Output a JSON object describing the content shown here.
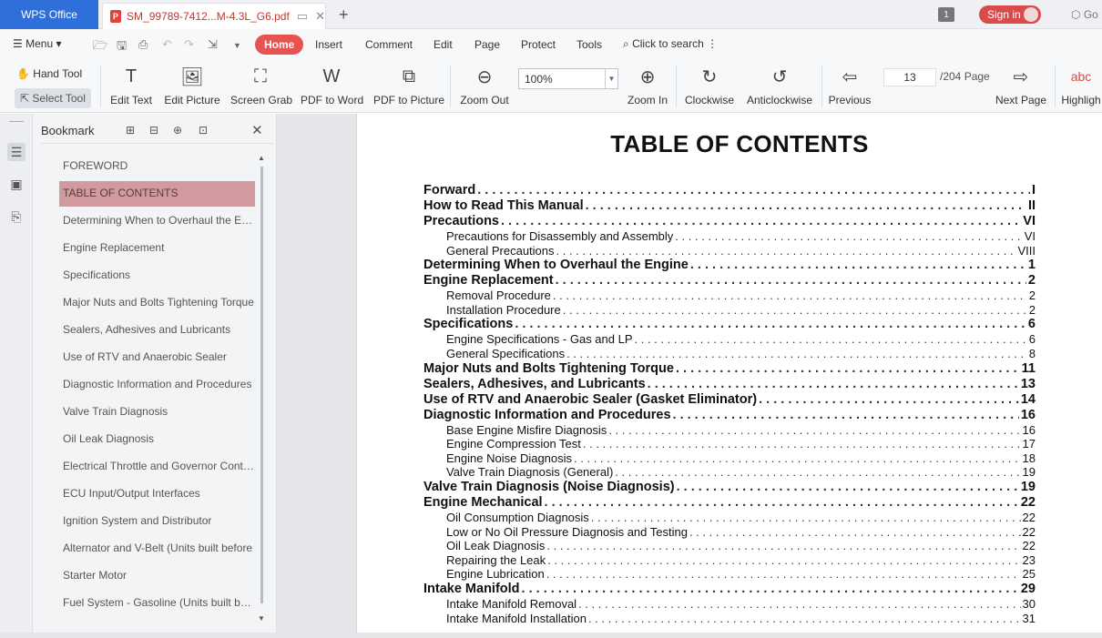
{
  "titlebar": {
    "app_name": "WPS Office",
    "doc_tab": "SM_99789-7412...M-4.3L_G6.pdf",
    "window_count": "1",
    "signin": "Sign in",
    "go_label": "Go"
  },
  "menubar": {
    "menu_label": "Menu",
    "tabs": [
      "Home",
      "Insert",
      "Comment",
      "Edit",
      "Page",
      "Protect",
      "Tools"
    ],
    "search_label": "Click to search"
  },
  "toolbar": {
    "hand_tool": "Hand Tool",
    "select_tool": "Select Tool",
    "edit_text": "Edit Text",
    "edit_picture": "Edit Picture",
    "screen_grab": "Screen Grab",
    "pdf_to_word": "PDF to Word",
    "pdf_to_picture": "PDF to Picture",
    "zoom_out": "Zoom Out",
    "zoom_value": "100%",
    "zoom_in": "Zoom In",
    "clockwise": "Clockwise",
    "anticlockwise": "Anticlockwise",
    "previous": "Previous",
    "page_number": "13",
    "page_total": "/204 Page",
    "next_page": "Next Page",
    "highlight": "Highligh"
  },
  "bookmark": {
    "title": "Bookmark",
    "items": [
      "FOREWORD",
      "TABLE OF CONTENTS",
      "Determining When to Overhaul the Engine",
      "Engine Replacement",
      "Specifications",
      "Major Nuts and Bolts Tightening Torque",
      "Sealers, Adhesives and Lubricants",
      "Use of RTV and Anaerobic Sealer",
      "Diagnostic Information and Procedures",
      "Valve Train Diagnosis",
      "Oil Leak Diagnosis",
      "Electrical Throttle and Governor Control",
      "ECU Input/Output Interfaces",
      "Ignition System and Distributor",
      "Alternator and V-Belt (Units built before",
      "Starter Motor",
      "Fuel System - Gasoline (Units built before"
    ],
    "selected_index": 1
  },
  "document": {
    "heading": "TABLE OF CONTENTS",
    "entries": [
      {
        "title": "Forward",
        "page": "I",
        "level": "main"
      },
      {
        "title": "How to Read This Manual",
        "page": "II",
        "level": "main"
      },
      {
        "title": "Precautions",
        "page": "VI",
        "level": "main"
      },
      {
        "title": "Precautions for Disassembly and Assembly",
        "page": "VI",
        "level": "sub"
      },
      {
        "title": "General Precautions",
        "page": "VIII",
        "level": "sub"
      },
      {
        "title": "Determining When to Overhaul the Engine",
        "page": "1",
        "level": "main"
      },
      {
        "title": "Engine Replacement",
        "page": "2",
        "level": "main"
      },
      {
        "title": "Removal Procedure",
        "page": "2",
        "level": "sub"
      },
      {
        "title": "Installation Procedure",
        "page": "2",
        "level": "sub"
      },
      {
        "title": "Specifications",
        "page": "6",
        "level": "main"
      },
      {
        "title": "Engine Specifications - Gas and LP",
        "page": "6",
        "level": "sub"
      },
      {
        "title": "General Specifications",
        "page": "8",
        "level": "sub"
      },
      {
        "title": "Major Nuts and Bolts Tightening Torque",
        "page": "11",
        "level": "main"
      },
      {
        "title": "Sealers, Adhesives, and Lubricants",
        "page": "13",
        "level": "main"
      },
      {
        "title": "Use of RTV and Anaerobic Sealer (Gasket Eliminator)",
        "page": "14",
        "level": "main"
      },
      {
        "title": "Diagnostic Information and Procedures",
        "page": "16",
        "level": "main"
      },
      {
        "title": "Base Engine Misfire Diagnosis",
        "page": "16",
        "level": "sub"
      },
      {
        "title": "Engine Compression Test",
        "page": "17",
        "level": "sub"
      },
      {
        "title": "Engine Noise Diagnosis",
        "page": "18",
        "level": "sub"
      },
      {
        "title": "Valve Train Diagnosis (General)",
        "page": "19",
        "level": "sub"
      },
      {
        "title": "Valve Train Diagnosis (Noise Diagnosis)",
        "page": "19",
        "level": "main"
      },
      {
        "title": "Engine Mechanical",
        "page": "22",
        "level": "main"
      },
      {
        "title": "Oil Consumption Diagnosis",
        "page": "22",
        "level": "sub"
      },
      {
        "title": "Low or No Oil Pressure Diagnosis and Testing",
        "page": "22",
        "level": "sub"
      },
      {
        "title": "Oil Leak Diagnosis",
        "page": "22",
        "level": "sub"
      },
      {
        "title": "Repairing the Leak",
        "page": "23",
        "level": "sub"
      },
      {
        "title": "Engine Lubrication",
        "page": "25",
        "level": "sub"
      },
      {
        "title": "Intake Manifold",
        "page": "29",
        "level": "main"
      },
      {
        "title": "Intake Manifold Removal",
        "page": "30",
        "level": "sub"
      },
      {
        "title": "Intake Manifold Installation",
        "page": "31",
        "level": "sub"
      }
    ]
  }
}
